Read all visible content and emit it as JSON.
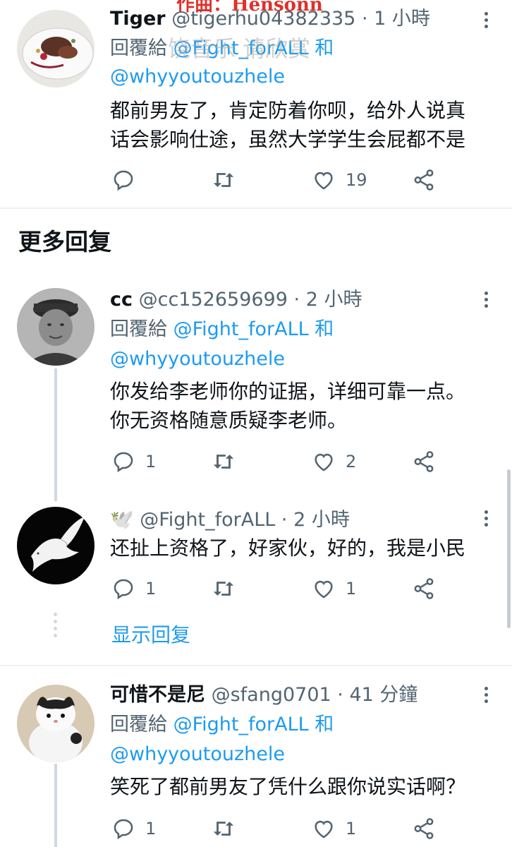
{
  "watermark": {
    "top_text": "作曲：Hensonn",
    "mid_text": "饶音乐  请欣赏"
  },
  "tweets": [
    {
      "name": "Tiger",
      "handle": "@tigerhu04382335",
      "time": "1 小時",
      "reply_prefix": "回覆給",
      "reply_user1": "@Fight_forALL",
      "reply_and": "和",
      "reply_user2": "@whyyoutouzhele",
      "body_lines": [
        "都前男友了，肯定防着你呗，给外人说真",
        "话会影响仕途，虽然大学学生会屁都不是"
      ],
      "replies": "",
      "retweets": "",
      "likes": "19",
      "avatar_icon": "food-plate-avatar"
    },
    {
      "name": "cc",
      "handle": "@cc152659699",
      "time": "2 小時",
      "reply_prefix": "回覆給",
      "reply_user1": "@Fight_forALL",
      "reply_and": "和",
      "reply_user2": "@whyyoutouzhele",
      "body_lines": [
        "你发给李老师你的证据，详细可靠一点。",
        "你无资格随意质疑李老师。"
      ],
      "replies": "1",
      "retweets": "",
      "likes": "2",
      "avatar_icon": "portrait-avatar"
    },
    {
      "name": "🕊️",
      "handle": "@Fight_forALL",
      "time": "2 小時",
      "body_lines": [
        "还扯上资格了，好家伙，好的，我是小民"
      ],
      "replies": "1",
      "retweets": "",
      "likes": "1",
      "avatar_icon": "dove-avatar"
    },
    {
      "name": "可惜不是尼",
      "handle": "@sfang0701",
      "time": "41 分鐘",
      "reply_prefix": "回覆給",
      "reply_user1": "@Fight_forALL",
      "reply_and": "和",
      "reply_user2": "@whyyoutouzhele",
      "body_lines": [
        "笑死了都前男友了凭什么跟你说实话啊？"
      ],
      "replies": "1",
      "retweets": "",
      "likes": "1",
      "avatar_icon": "cat-avatar"
    }
  ],
  "section_title": "更多回复",
  "show_replies": "显示回复",
  "separator": "·",
  "colors": {
    "accent": "#1d9bf0",
    "secondary": "#536471",
    "divider": "#eff3f4"
  }
}
